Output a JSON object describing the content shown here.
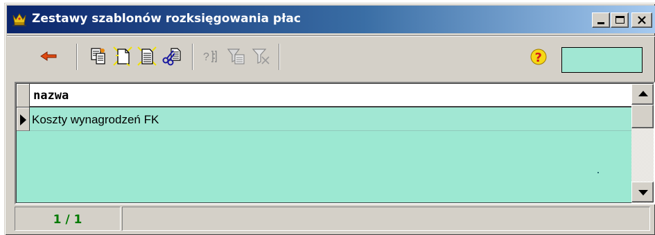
{
  "window": {
    "title": "Zestawy szablonów rozksięgowania płac",
    "icon": "crown-icon",
    "controls": [
      "minimize-icon",
      "maximize-icon",
      "close-icon"
    ]
  },
  "toolbar": {
    "buttons": [
      {
        "name": "back-button",
        "icon": "arrow-left-icon",
        "enabled": true
      },
      {
        "name": "copy-record-button",
        "icon": "copy-document-icon",
        "enabled": true
      },
      {
        "name": "new-record-button",
        "icon": "new-document-icon",
        "enabled": true
      },
      {
        "name": "edit-record-button",
        "icon": "edit-document-icon",
        "enabled": true
      },
      {
        "name": "cut-record-button",
        "icon": "scissors-document-icon",
        "enabled": true
      },
      {
        "name": "search-button",
        "icon": "search-binoculars-icon",
        "enabled": false
      },
      {
        "name": "filter-button",
        "icon": "filter-icon",
        "enabled": false
      },
      {
        "name": "clear-filter-button",
        "icon": "filter-clear-icon",
        "enabled": false
      },
      {
        "name": "help-button",
        "icon": "help-icon",
        "enabled": true
      }
    ],
    "status_box_color": "#a1e7d3"
  },
  "grid": {
    "columns": [
      {
        "key": "nazwa",
        "label": "nazwa"
      }
    ],
    "rows": [
      {
        "nazwa": "Koszty wynagrodzeń FK",
        "selected": true
      }
    ],
    "row_color": "#a1e7d3",
    "background_color": "#9ce8d2"
  },
  "statusbar": {
    "record_position": "1 / 1",
    "record_position_color": "#007a00"
  }
}
